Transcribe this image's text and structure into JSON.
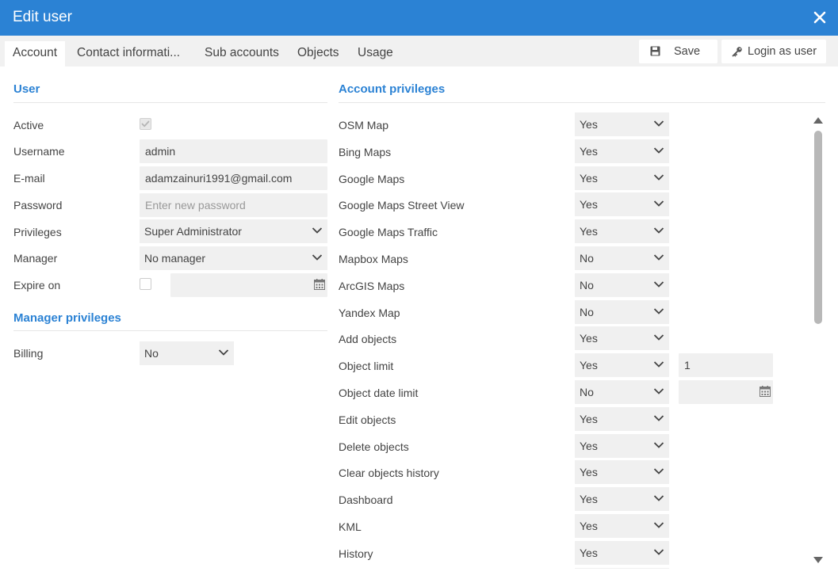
{
  "window": {
    "title": "Edit user",
    "close_icon": "close-icon"
  },
  "tabs": [
    "Account",
    "Contact informati...",
    "Sub accounts",
    "Objects",
    "Usage"
  ],
  "toolbar": {
    "save_label": "Save",
    "save_icon": "floppy-disk-icon",
    "login_label": "Login as user",
    "login_icon": "key-icon"
  },
  "user": {
    "section_title": "User",
    "active_label": "Active",
    "active_checked": true,
    "username_label": "Username",
    "username_value": "admin",
    "email_label": "E-mail",
    "email_value": "adamzainuri1991@gmail.com",
    "password_label": "Password",
    "password_placeholder": "Enter new password",
    "privileges_label": "Privileges",
    "privileges_value": "Super Administrator",
    "manager_label": "Manager",
    "manager_value": "No manager",
    "expire_label": "Expire on",
    "expire_checked": false,
    "expire_value": ""
  },
  "manager_privileges": {
    "section_title": "Manager privileges",
    "billing_label": "Billing",
    "billing_value": "No"
  },
  "account_privileges": {
    "section_title": "Account privileges",
    "items": [
      {
        "label": "OSM Map",
        "value": "Yes"
      },
      {
        "label": "Bing Maps",
        "value": "Yes"
      },
      {
        "label": "Google Maps",
        "value": "Yes"
      },
      {
        "label": "Google Maps Street View",
        "value": "Yes"
      },
      {
        "label": "Google Maps Traffic",
        "value": "Yes"
      },
      {
        "label": "Mapbox Maps",
        "value": "No"
      },
      {
        "label": "ArcGIS Maps",
        "value": "No"
      },
      {
        "label": "Yandex Map",
        "value": "No"
      },
      {
        "label": "Add objects",
        "value": "Yes"
      },
      {
        "label": "Object limit",
        "value": "Yes"
      },
      {
        "label": "Object date limit",
        "value": "No"
      },
      {
        "label": "Edit objects",
        "value": "Yes"
      },
      {
        "label": "Delete objects",
        "value": "Yes"
      },
      {
        "label": "Clear objects history",
        "value": "Yes"
      },
      {
        "label": "Dashboard",
        "value": "Yes"
      },
      {
        "label": "KML",
        "value": "Yes"
      },
      {
        "label": "History",
        "value": "Yes"
      }
    ],
    "object_limit_value": "1",
    "object_date_limit_value": ""
  },
  "colors": {
    "accent": "#2b82d4",
    "tabbar": "#f1f1f1",
    "field": "#f0f0f0"
  }
}
